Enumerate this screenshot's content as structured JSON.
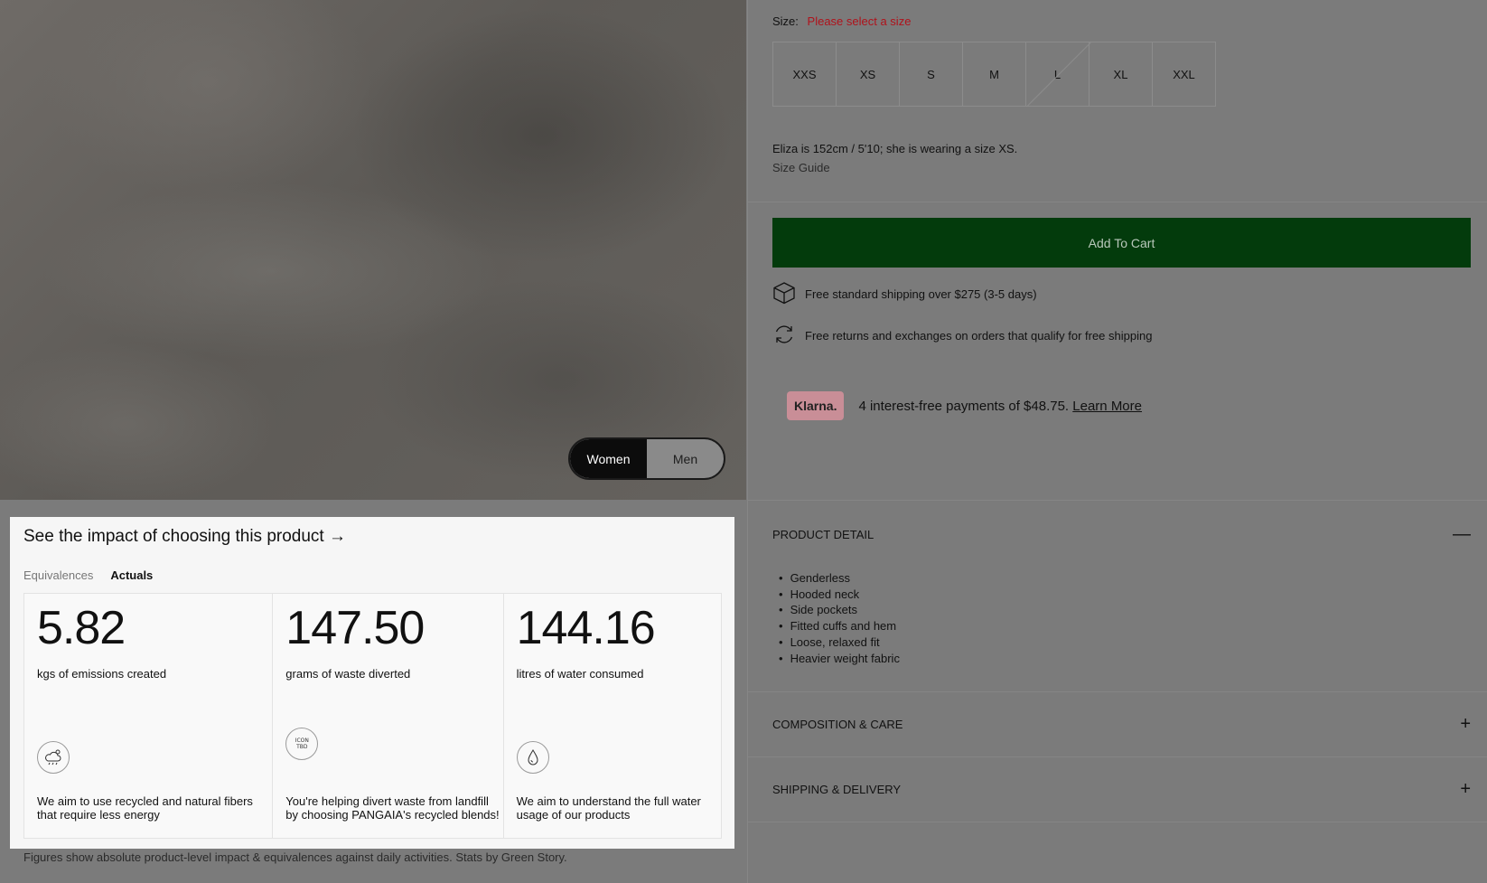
{
  "gender_toggle": {
    "options": [
      "Women",
      "Men"
    ],
    "selected": "Women"
  },
  "impact": {
    "title": "See the impact of choosing this product →",
    "tabs": [
      "Equivalences",
      "Actuals"
    ],
    "active_tab": "Actuals",
    "stats": [
      {
        "value": "5.82",
        "label": "kgs of emissions created",
        "icon": "cloud-sun-icon",
        "description": "We aim to use recycled and natural fibers that require less energy"
      },
      {
        "value": "147.50",
        "label": "grams of waste diverted",
        "icon": "icon-tbd-icon",
        "icon_text": "ICON TBD",
        "description": "You're helping divert waste from landfill by choosing PANGAIA's recycled blends!"
      },
      {
        "value": "144.16",
        "label": "litres of water consumed",
        "icon": "water-drop-icon",
        "description": "We aim to understand the full water usage of our products"
      }
    ],
    "footnote": "Figures show absolute product-level impact & equivalences against daily activities. Stats by Green Story."
  },
  "size": {
    "label": "Size:",
    "warning": "Please select a size",
    "options": [
      "XXS",
      "XS",
      "S",
      "M",
      "L",
      "XL",
      "XXL"
    ],
    "out_of_stock": [
      "L"
    ],
    "model_info": "Eliza is 152cm / 5'10; she is wearing a size XS.",
    "guide_label": "Size Guide"
  },
  "cart": {
    "add_label": "Add To Cart",
    "button_color": "#033b0c"
  },
  "perks": [
    {
      "icon": "box-icon",
      "text": "Free standard shipping over $275 (3-5 days)"
    },
    {
      "icon": "refresh-icon",
      "text": "Free returns and exchanges on orders that qualify for free shipping"
    }
  ],
  "klarna": {
    "badge": "Klarna.",
    "text": "4 interest-free payments of $48.75.",
    "link": "Learn More"
  },
  "accordions": [
    {
      "title": "PRODUCT DETAIL",
      "sign": "—",
      "expanded": true,
      "items": [
        "Genderless",
        "Hooded neck",
        "Side pockets",
        "Fitted cuffs and hem",
        "Loose, relaxed fit",
        "Heavier weight fabric"
      ]
    },
    {
      "title": "COMPOSITION & CARE",
      "sign": "+",
      "expanded": false
    },
    {
      "title": "SHIPPING & DELIVERY",
      "sign": "+",
      "expanded": false
    }
  ]
}
